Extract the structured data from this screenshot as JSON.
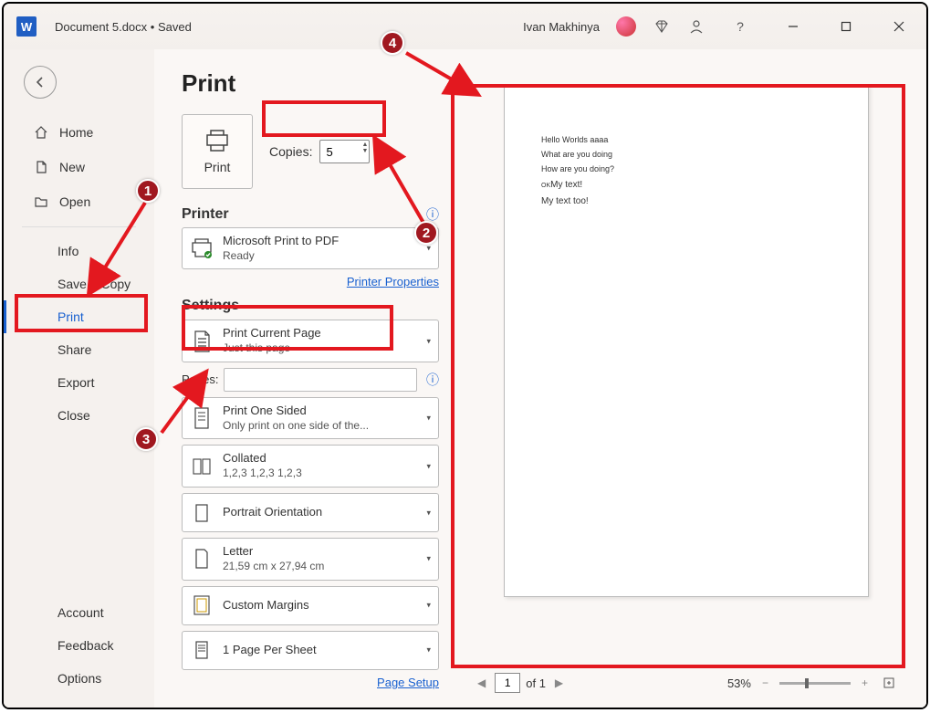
{
  "titlebar": {
    "doc_title": "Document 5.docx • Saved",
    "user_name": "Ivan Makhinya"
  },
  "sidebar": {
    "home": "Home",
    "new": "New",
    "open": "Open",
    "info": "Info",
    "save_copy": "Save a Copy",
    "print": "Print",
    "share": "Share",
    "export": "Export",
    "close": "Close",
    "account": "Account",
    "feedback": "Feedback",
    "options": "Options"
  },
  "panel": {
    "title": "Print",
    "print_btn": "Print",
    "copies_label": "Copies:",
    "copies_value": "5",
    "printer_label": "Printer",
    "printer_name": "Microsoft Print to PDF",
    "printer_status": "Ready",
    "printer_props": "Printer Properties",
    "settings_label": "Settings",
    "what_print": "Print Current Page",
    "what_print_sub": "Just this page",
    "pages_label": "Pages:",
    "one_sided": "Print One Sided",
    "one_sided_sub": "Only print on one side of the...",
    "collated": "Collated",
    "collated_sub": "1,2,3    1,2,3    1,2,3",
    "orientation": "Portrait Orientation",
    "paper": "Letter",
    "paper_sub": "21,59 cm x 27,94 cm",
    "margins": "Custom Margins",
    "pages_per_sheet": "1 Page Per Sheet",
    "page_setup": "Page Setup"
  },
  "preview": {
    "line1": "Hello Worlds aaaa",
    "line2": "What are you doing",
    "line3": "How are you doing?",
    "line4_sm": "OK",
    "line4": "My text!",
    "line5": "My text too!"
  },
  "footer": {
    "page_input": "1",
    "of_label": "of 1",
    "zoom": "53%"
  },
  "callouts": {
    "c1": "1",
    "c2": "2",
    "c3": "3",
    "c4": "4"
  }
}
